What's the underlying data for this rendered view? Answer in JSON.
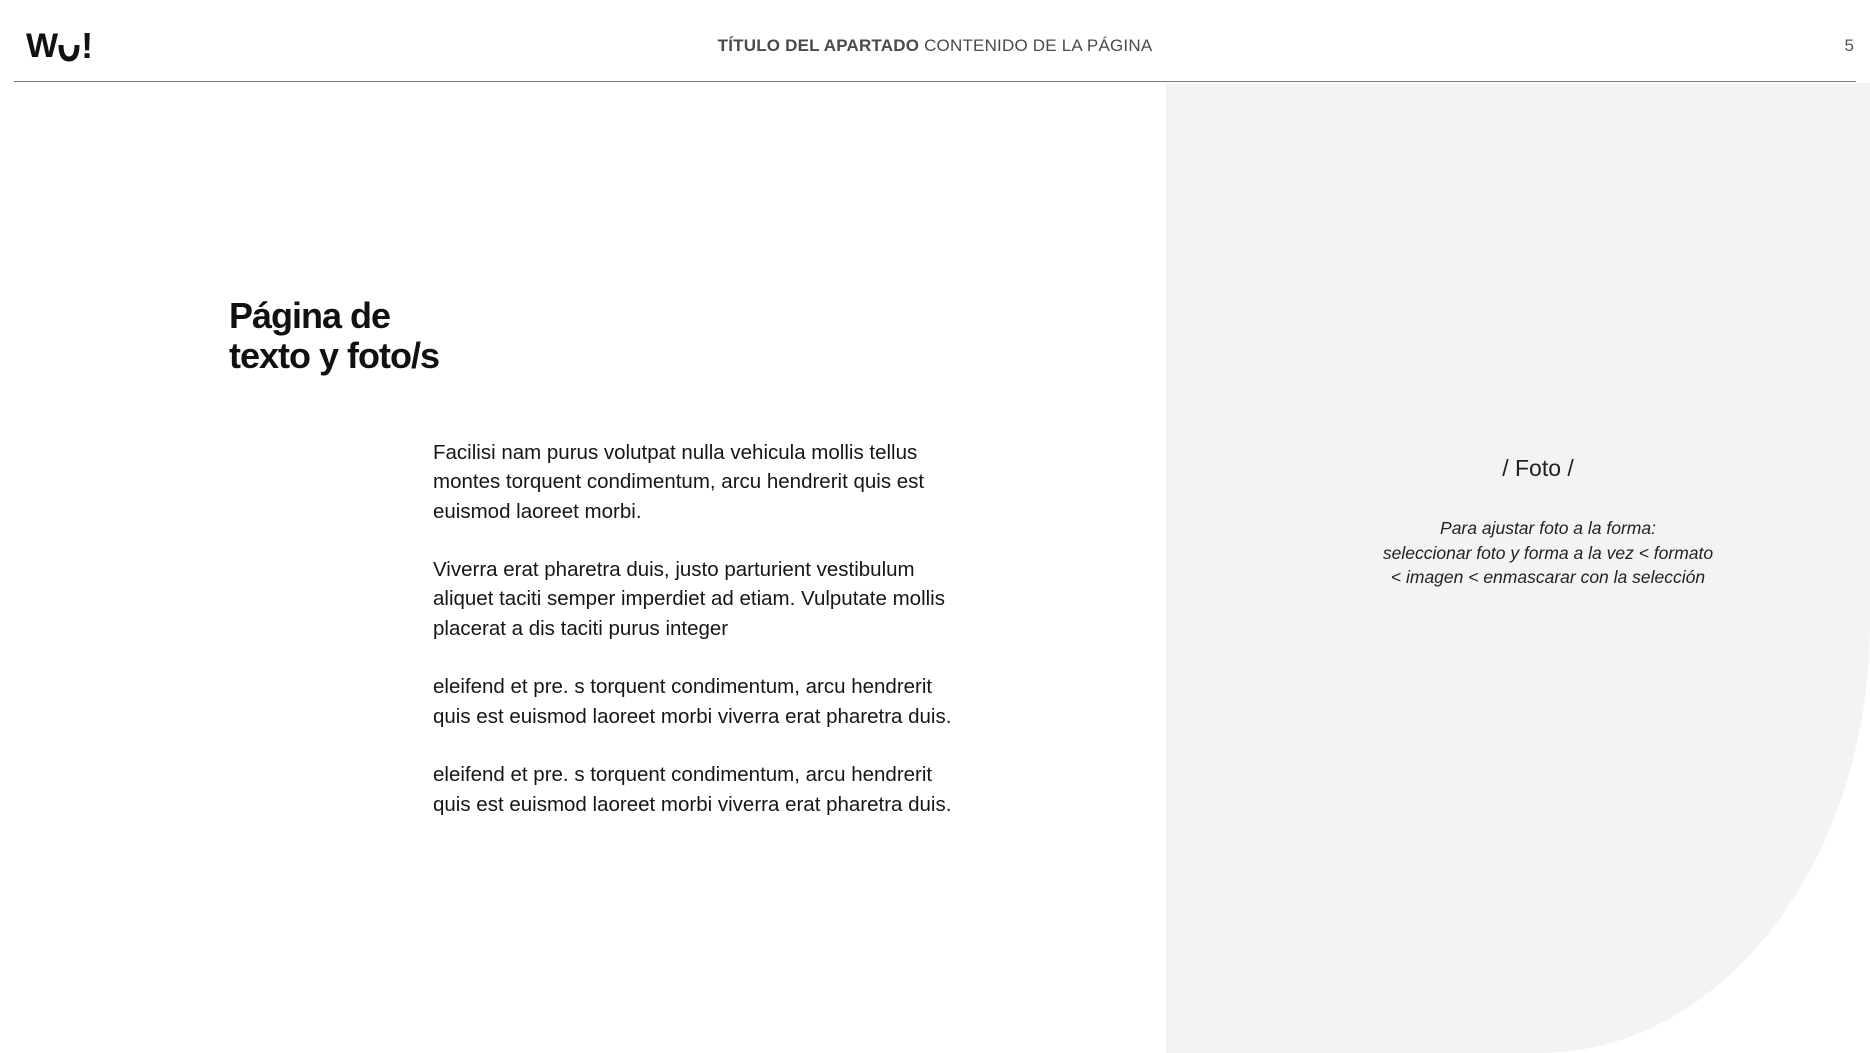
{
  "header": {
    "logo_text": "Wu!",
    "title_strong": "TÍTULO DEL APARTADO",
    "title_rest": "CONTENIDO DE LA PÁGINA",
    "page_number": "5"
  },
  "main": {
    "heading_line1": "Página de",
    "heading_line2": "texto y foto/s",
    "paragraphs": [
      "Facilisi nam purus volutpat nulla vehicula mollis tellus montes torquent condimentum, arcu hendrerit quis est euismod laoreet morbi.",
      "Viverra erat pharetra duis, justo parturient vestibulum aliquet taciti semper imperdiet ad etiam. Vulputate mollis placerat a dis taciti purus integer",
      "eleifend et pre. s torquent condimentum, arcu hendrerit quis est euismod laoreet morbi viverra erat pharetra duis.",
      "eleifend et pre. s torquent condimentum, arcu hendrerit quis est euismod laoreet morbi viverra erat pharetra duis."
    ]
  },
  "photo": {
    "label": "/ Foto /",
    "hint_line1": "Para ajustar foto a la forma:",
    "hint_line2": "seleccionar foto y forma a la vez < formato",
    "hint_line3": "< imagen < enmascarar con la selección"
  },
  "colors": {
    "panel_background": "#f3f3f3",
    "header_rule": "#7a7a7a",
    "text": "#111111"
  }
}
